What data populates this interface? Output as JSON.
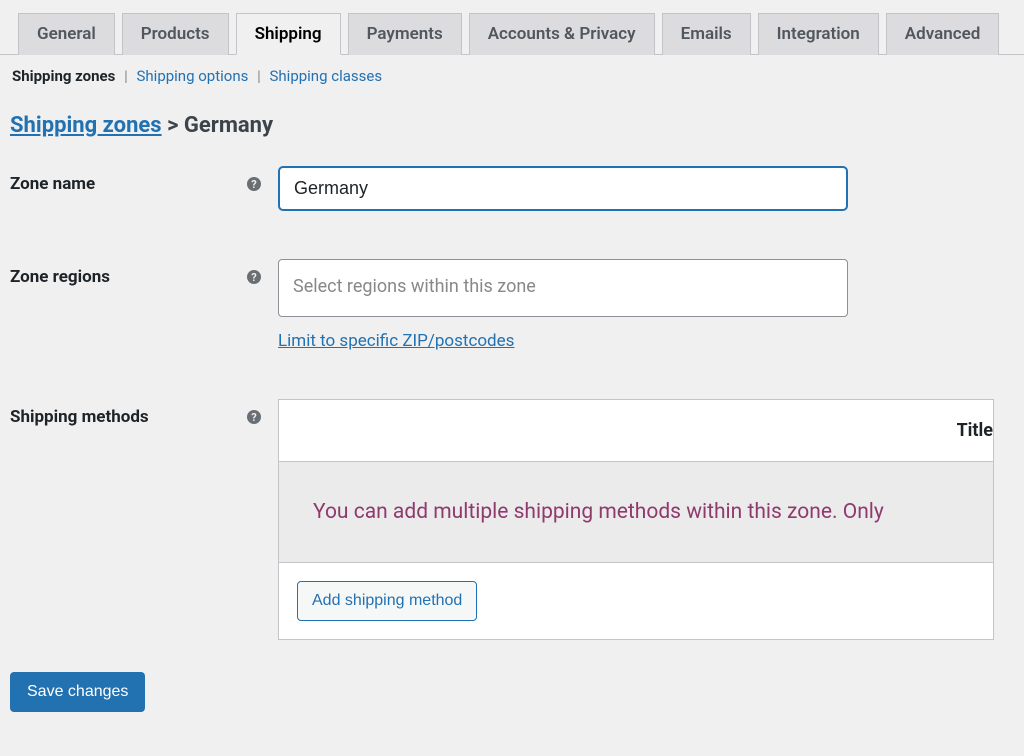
{
  "tabs": {
    "general": "General",
    "products": "Products",
    "shipping": "Shipping",
    "payments": "Payments",
    "accounts": "Accounts & Privacy",
    "emails": "Emails",
    "integration": "Integration",
    "advanced": "Advanced"
  },
  "subnav": {
    "zones": "Shipping zones",
    "options": "Shipping options",
    "classes": "Shipping classes"
  },
  "breadcrumb": {
    "link": "Shipping zones",
    "sep": ">",
    "current": "Germany"
  },
  "form": {
    "zone_name_label": "Zone name",
    "zone_name_value": "Germany",
    "zone_regions_label": "Zone regions",
    "zone_regions_placeholder": "Select regions within this zone",
    "zip_link": "Limit to specific ZIP/postcodes",
    "shipping_methods_label": "Shipping methods"
  },
  "methods": {
    "title_header": "Title",
    "empty_text": "You can add multiple shipping methods within this zone. Only",
    "add_button": "Add shipping method"
  },
  "save_button": "Save changes"
}
